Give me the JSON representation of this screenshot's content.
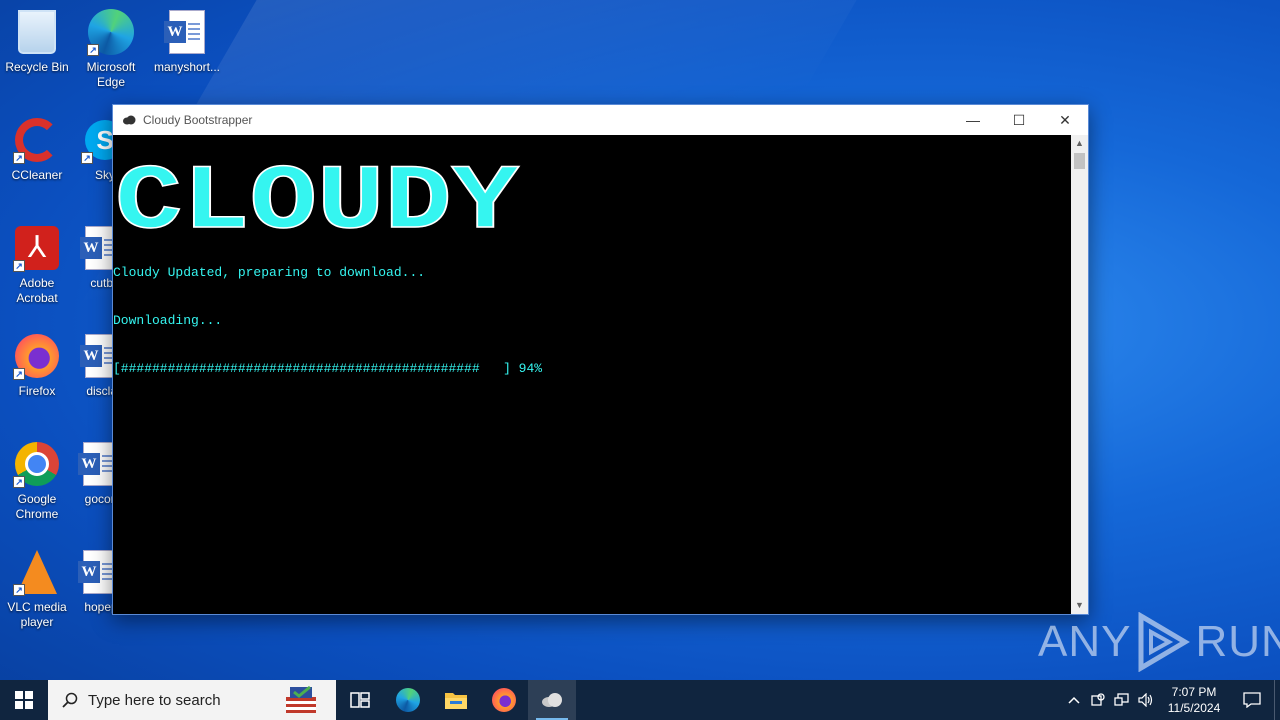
{
  "desktop": {
    "icons": [
      {
        "label": "Recycle Bin",
        "icon": "recycle-bin-icon"
      },
      {
        "label": "Microsoft Edge",
        "icon": "edge-icon"
      },
      {
        "label": "manyshort...",
        "icon": "word-doc-icon"
      },
      {
        "label": "CCleaner",
        "icon": "ccleaner-icon"
      },
      {
        "label": "Sky",
        "icon": "skype-icon"
      },
      {
        "label": "Adobe Acrobat",
        "icon": "acrobat-icon"
      },
      {
        "label": "cutbl",
        "icon": "word-doc-icon"
      },
      {
        "label": "Firefox",
        "icon": "firefox-icon"
      },
      {
        "label": "disclai",
        "icon": "word-doc-icon"
      },
      {
        "label": "Google Chrome",
        "icon": "chrome-icon"
      },
      {
        "label": "gocon",
        "icon": "word-doc-icon"
      },
      {
        "label": "VLC media player",
        "icon": "vlc-icon"
      },
      {
        "label": "hopep",
        "icon": "word-doc-icon"
      }
    ]
  },
  "window": {
    "title": "Cloudy Bootstrapper",
    "minimize_glyph": "—",
    "maximize_glyph": "☐",
    "close_glyph": "✕",
    "banner_text": "CLOUDY",
    "console_lines": [
      "Cloudy Updated, preparing to download...",
      "Downloading...",
      "[##############################################   ] 94%"
    ],
    "progress_percent": 94
  },
  "watermark": {
    "left": "ANY",
    "right": "RUN"
  },
  "taskbar": {
    "search_placeholder": "Type here to search",
    "clock_time": "7:07 PM",
    "clock_date": "11/5/2024",
    "pinned": [
      "task-view-icon",
      "edge-icon",
      "file-explorer-icon",
      "firefox-icon",
      "cloudy-icon"
    ]
  },
  "colors": {
    "console_text": "#35f5f0",
    "taskbar_bg": "#10253f",
    "desktop_bg": "#1568d8"
  }
}
